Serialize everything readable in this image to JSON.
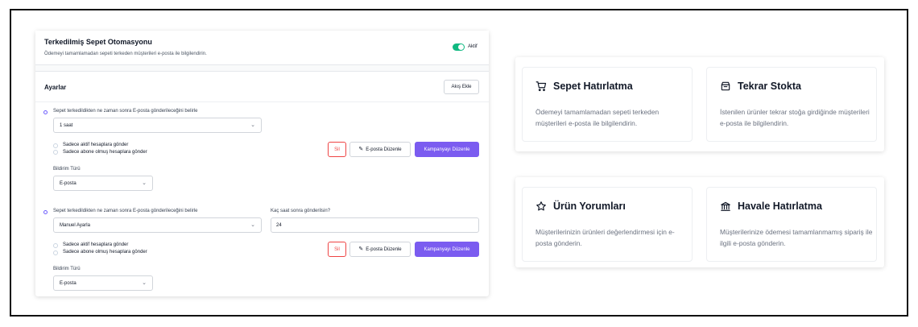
{
  "panel": {
    "title": "Terkedilmiş Sepet Otomasyonu",
    "subtitle": "Ödemeyi tamamlamadan sepeti terkeden müşterileri e-posta ile bilgilendirin.",
    "toggle_label": "Aktif",
    "settings_title": "Ayarlar",
    "add_flow_label": "Akış Ekle",
    "flows": [
      {
        "question": "Sepet terkedildikten ne zaman sonra E-posta gönderileceğini belirle",
        "timing_value": "1 saat",
        "options": [
          "Sadece aktif hesaplara gönder",
          "Sadece abone olmuş hesaplara gönder"
        ],
        "delete_label": "Sil",
        "edit_email_label": "E-posta Düzenle",
        "edit_campaign_label": "Kampanyayı Düzenle",
        "notification_label": "Bildirim Türü",
        "notification_value": "E-posta"
      },
      {
        "question": "Sepet terkedildikten ne zaman sonra E-posta gönderileceğini belirle",
        "timing_value": "Manuel Ayarla",
        "hours_label": "Kaç saat sonra gönderilsin?",
        "hours_value": "24",
        "options": [
          "Sadece aktif hesaplara gönder",
          "Sadece abone olmuş hesaplara gönder"
        ],
        "delete_label": "Sil",
        "edit_email_label": "E-posta Düzenle",
        "edit_campaign_label": "Kampanyayı Düzenle",
        "notification_label": "Bildirim Türü",
        "notification_value": "E-posta"
      }
    ]
  },
  "cards": [
    {
      "title": "Sepet Hatırlatma",
      "desc": "Ödemeyi tamamlamadan sepeti terkeden müşterileri e-posta ile bilgilendirin.",
      "icon": "cart-icon"
    },
    {
      "title": "Tekrar Stokta",
      "desc": "İstenilen ürünler tekrar stoğa girdiğinde müşterileri e-posta ile bilgilendirin.",
      "icon": "box-icon"
    },
    {
      "title": "Ürün Yorumları",
      "desc": "Müşterilerinizin ürünleri değerlendirmesi için e-posta gönderin.",
      "icon": "star-icon"
    },
    {
      "title": "Havale Hatırlatma",
      "desc": "Müşterilerinize ödemesi tamamlanmamış sipariş ile ilgili e-posta gönderin.",
      "icon": "bank-icon"
    }
  ]
}
